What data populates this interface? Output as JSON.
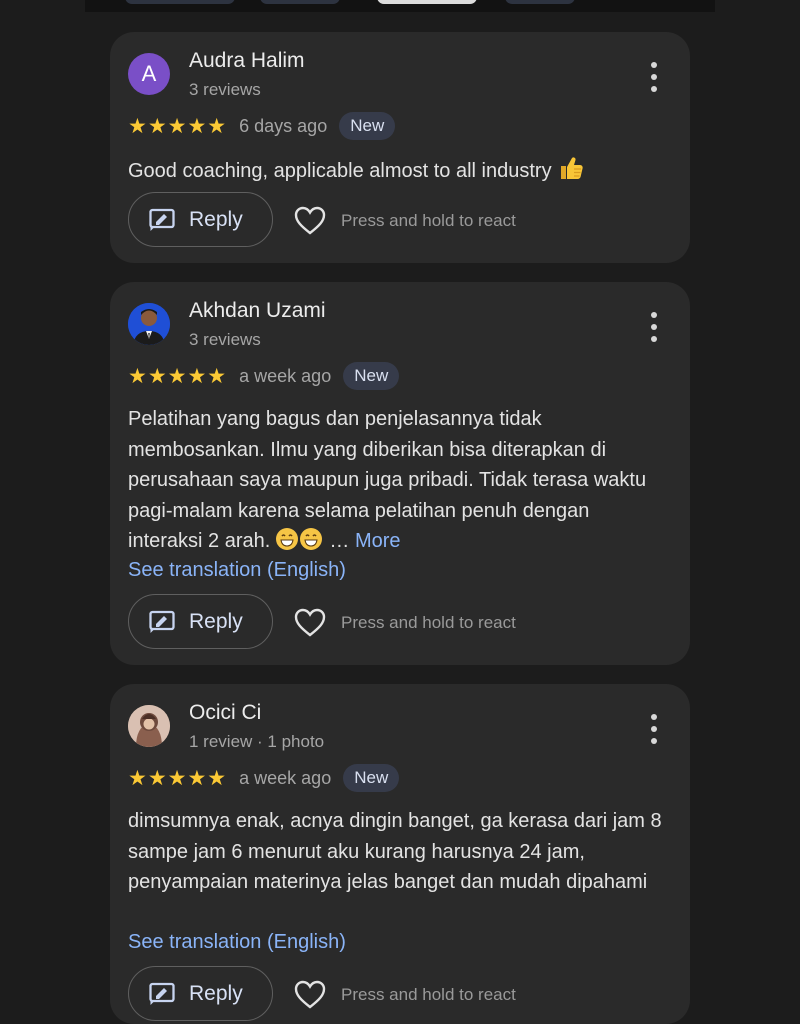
{
  "reviews": [
    {
      "avatar_letter": "A",
      "name": "Audra Halim",
      "meta": "3 reviews",
      "stars": "★★★★★",
      "time": "6 days ago",
      "badge": "New",
      "text": "Good coaching, applicable almost to all industry",
      "emoji": "thumbs-up",
      "reply_label": "Reply",
      "react_label": "Press and hold to react"
    },
    {
      "name": "Akhdan Uzami",
      "meta": "3 reviews",
      "stars": "★★★★★",
      "time": "a week ago",
      "badge": "New",
      "text": "Pelatihan yang bagus dan penjelasannya tidak membosankan. Ilmu yang diberikan bisa diterapkan di perusahaan saya maupun juga pribadi. Tidak terasa waktu pagi-malam karena selama pelatihan penuh dengan interaksi 2 arah.",
      "emoji": "grinning-face ×2",
      "ellipsis": "…",
      "more_label": "More",
      "translate_label": "See translation (English)",
      "reply_label": "Reply",
      "react_label": "Press and hold to react"
    },
    {
      "name": "Ocici Ci",
      "meta": "1 review · 1 photo",
      "stars": "★★★★★",
      "time": "a week ago",
      "badge": "New",
      "text": "dimsumnya enak, acnya dingin banget, ga kerasa dari jam 8 sampe jam 6 menurut aku kurang harusnya 24 jam, penyampaian materinya jelas banget dan mudah dipahami",
      "translate_label": "See translation (English)",
      "reply_label": "Reply",
      "react_label": "Press and hold to react"
    }
  ],
  "colors": {
    "background": "#1c1c1c",
    "card": "#2a2a2a",
    "star": "#fbc935",
    "link": "#8ab4f8",
    "badge_bg": "#363b4a"
  }
}
